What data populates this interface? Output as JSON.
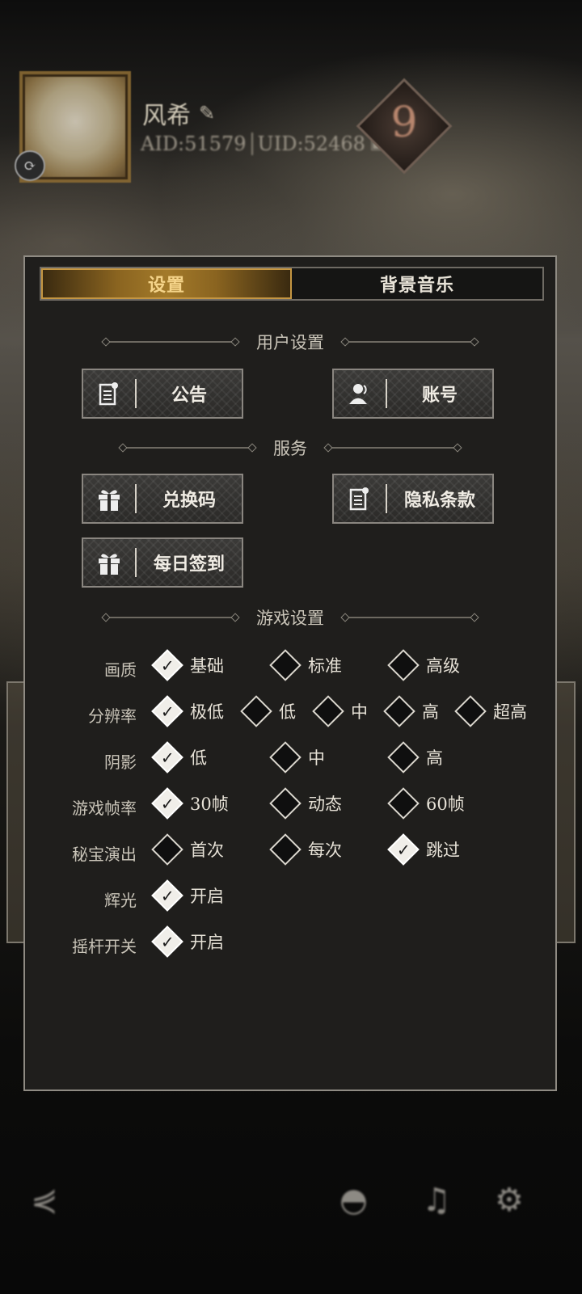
{
  "profile": {
    "name": "风希",
    "aid": "AID:51579",
    "uid": "UID:52468",
    "level": "9",
    "edit_icon": "edit-icon",
    "copy_icon": "copy-icon"
  },
  "tabs": [
    {
      "label": "设置",
      "active": true
    },
    {
      "label": "背景音乐",
      "active": false
    }
  ],
  "sections": {
    "user": "用户设置",
    "service": "服务",
    "game": "游戏设置"
  },
  "buttons": {
    "notice": {
      "label": "公告",
      "icon": "document-icon"
    },
    "account": {
      "label": "账号",
      "icon": "user-icon"
    },
    "redeem": {
      "label": "兑换码",
      "icon": "gift-icon"
    },
    "privacy": {
      "label": "隐私条款",
      "icon": "document-icon"
    },
    "checkin": {
      "label": "每日签到",
      "icon": "gift-icon"
    }
  },
  "settings": [
    {
      "label": "画质",
      "options": [
        "基础",
        "标准",
        "高级"
      ],
      "selected": 0
    },
    {
      "label": "分辨率",
      "options": [
        "极低",
        "低",
        "中",
        "高",
        "超高"
      ],
      "selected": 0
    },
    {
      "label": "阴影",
      "options": [
        "低",
        "中",
        "高"
      ],
      "selected": 0
    },
    {
      "label": "游戏帧率",
      "options": [
        "30帧",
        "动态",
        "60帧"
      ],
      "selected": 0
    },
    {
      "label": "秘宝演出",
      "options": [
        "首次",
        "每次",
        "跳过"
      ],
      "selected": 2
    },
    {
      "label": "辉光",
      "options": [
        "开启"
      ],
      "selected": 0
    },
    {
      "label": "摇杆开关",
      "options": [
        "开启"
      ],
      "selected": 0
    }
  ],
  "colors": {
    "panel_bg": "#1f1e1c",
    "tab_active": "#a37a2a",
    "check_on": "#f0eee9"
  }
}
